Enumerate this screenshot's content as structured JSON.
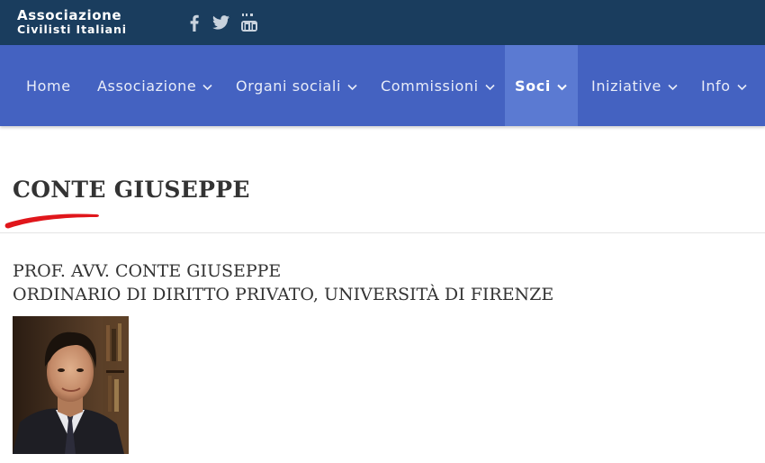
{
  "header": {
    "logo_line1": "Associazione",
    "logo_line2": "Civilisti Italiani",
    "social": [
      "facebook-icon",
      "twitter-icon",
      "youtube-icon"
    ],
    "background": "#1a3d5e"
  },
  "nav": {
    "background": "#4462c1",
    "active_background": "#5b7ad2",
    "items": [
      {
        "label": "Home",
        "has_dropdown": false
      },
      {
        "label": "Associazione",
        "has_dropdown": true
      },
      {
        "label": "Organi sociali",
        "has_dropdown": true
      },
      {
        "label": "Commissioni",
        "has_dropdown": true
      },
      {
        "label": "Soci",
        "has_dropdown": true,
        "active": true
      },
      {
        "label": "Iniziative",
        "has_dropdown": true
      },
      {
        "label": "Info",
        "has_dropdown": true
      }
    ]
  },
  "main": {
    "page_title": "CONTE GIUSEPPE",
    "subtitle_line1": "PROF. AVV. CONTE GIUSEPPE",
    "subtitle_line2": "ORDINARIO DI DIRITTO PRIVATO, UNIVERSITÀ DI FIRENZE",
    "annotation_color": "#e0161b"
  }
}
